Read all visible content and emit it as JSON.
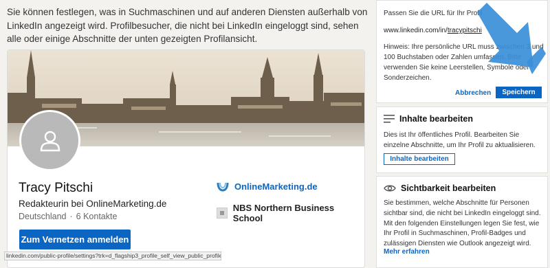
{
  "intro": {
    "text": "Sie können festlegen, was in Suchmaschinen und auf anderen Diensten außerhalb von LinkedIn angezeigt wird. Profilbesucher, die nicht bei LinkedIn eingeloggt sind, sehen alle oder einige Abschnitte der unten gezeigten Profilansicht."
  },
  "profile": {
    "name": "Tracy Pitschi",
    "headline": "Redakteurin bei OnlineMarketing.de",
    "location": "Deutschland",
    "dot": "·",
    "contacts": "6 Kontakte",
    "connect_button": "Zum Vernetzen anmelden",
    "company": "OnlineMarketing.de",
    "school": "NBS Northern Business School"
  },
  "statusbar": {
    "url": "linkedin.com/public-profile/settings?trk=d_flagship3_profile_self_view_public_profile"
  },
  "url_panel": {
    "label": "Passen Sie die URL für Ihr Profil",
    "url_prefix": "www.linkedin.com/in/",
    "url_value": "tracypitschi",
    "hint": "Hinweis: Ihre persönliche URL muss zwischen 3 und 100 Buchstaben oder Zahlen umfassen. Bitte verwenden Sie keine Leerstellen, Symbole oder Sonderzeichen.",
    "cancel": "Abbrechen",
    "save": "Speichern"
  },
  "content_panel": {
    "title": "Inhalte bearbeiten",
    "text": "Dies ist Ihr öffentliches Profil. Bearbeiten Sie einzelne Abschnitte, um Ihr Profil zu aktualisieren.",
    "button": "Inhalte bearbeiten"
  },
  "visibility_panel": {
    "title": "Sichtbarkeit bearbeiten",
    "text": "Sie bestimmen, welche Abschnitte für Personen sichtbar sind, die nicht bei LinkedIn eingeloggt sind. Mit den folgenden Einstellungen legen Sie fest, wie Ihr Profil in Suchmaschinen, Profil-Badges und zulässigen Diensten wie Outlook angezeigt wird.",
    "more": "Mehr erfahren"
  },
  "colors": {
    "accent": "#0a66c2",
    "arrow": "#3b8fd9"
  }
}
